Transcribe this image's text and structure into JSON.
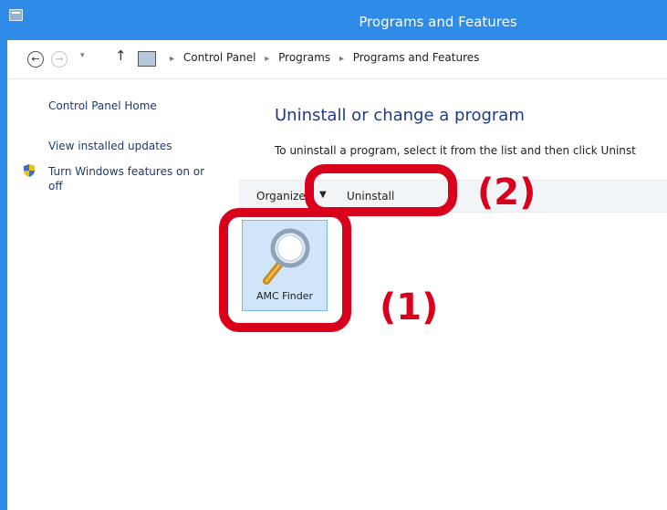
{
  "window": {
    "title": "Programs and Features",
    "icon": "control-panel-icon"
  },
  "address_bar": {
    "back_icon": "arrow-left-icon",
    "forward_icon": "arrow-right-icon",
    "up_icon": "arrow-up-icon",
    "breadcrumbs": [
      "Control Panel",
      "Programs",
      "Programs and Features"
    ]
  },
  "sidebar": {
    "links": [
      "Control Panel Home",
      "View installed updates",
      "Turn Windows features on or",
      "off"
    ]
  },
  "main": {
    "title": "Uninstall or change a program",
    "instruction": "To uninstall a program, select it from the list and then click Uninst"
  },
  "toolbar": {
    "organize_label": "Organize",
    "uninstall_label": "Uninstall"
  },
  "programs": [
    {
      "name": "AMC Finder",
      "icon": "magnifier-icon",
      "selected": true
    }
  ],
  "annotations": {
    "label_1": "(1)",
    "label_2": "(2)",
    "color": "#d8001a"
  },
  "colors": {
    "title_bar": "#2f8be8",
    "link": "#1e3a6e",
    "heading": "#1e3a8a",
    "selection": "#cfe6fa"
  }
}
